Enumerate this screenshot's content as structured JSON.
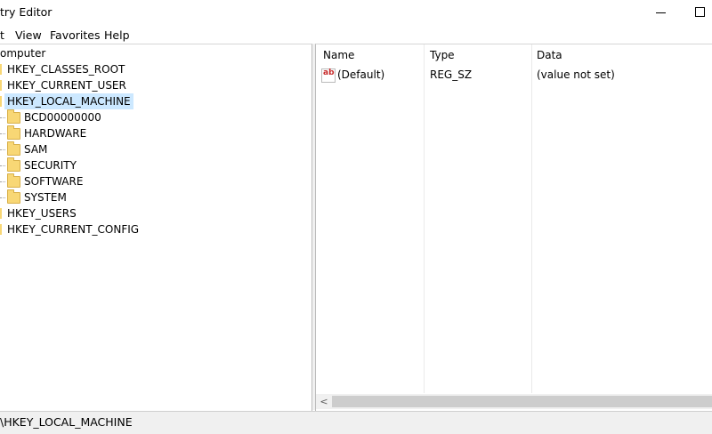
{
  "window": {
    "title": "try Editor"
  },
  "menu": [
    "t",
    "View",
    "Favorites",
    "Help"
  ],
  "tree": {
    "root": "omputer",
    "items": [
      {
        "label": "HKEY_CLASSES_ROOT"
      },
      {
        "label": "HKEY_CURRENT_USER"
      },
      {
        "label": "HKEY_LOCAL_MACHINE",
        "selected": true
      },
      {
        "label": "BCD00000000"
      },
      {
        "label": "HARDWARE"
      },
      {
        "label": "SAM"
      },
      {
        "label": "SECURITY"
      },
      {
        "label": "SOFTWARE"
      },
      {
        "label": "SYSTEM"
      },
      {
        "label": "HKEY_USERS"
      },
      {
        "label": "HKEY_CURRENT_CONFIG"
      }
    ]
  },
  "list": {
    "columns": [
      "Name",
      "Type",
      "Data"
    ],
    "rows": [
      {
        "name": "(Default)",
        "type": "REG_SZ",
        "data": "(value not set)",
        "icon": "ab"
      }
    ],
    "scroll_left_glyph": "<"
  },
  "status": {
    "path": "\\HKEY_LOCAL_MACHINE"
  }
}
